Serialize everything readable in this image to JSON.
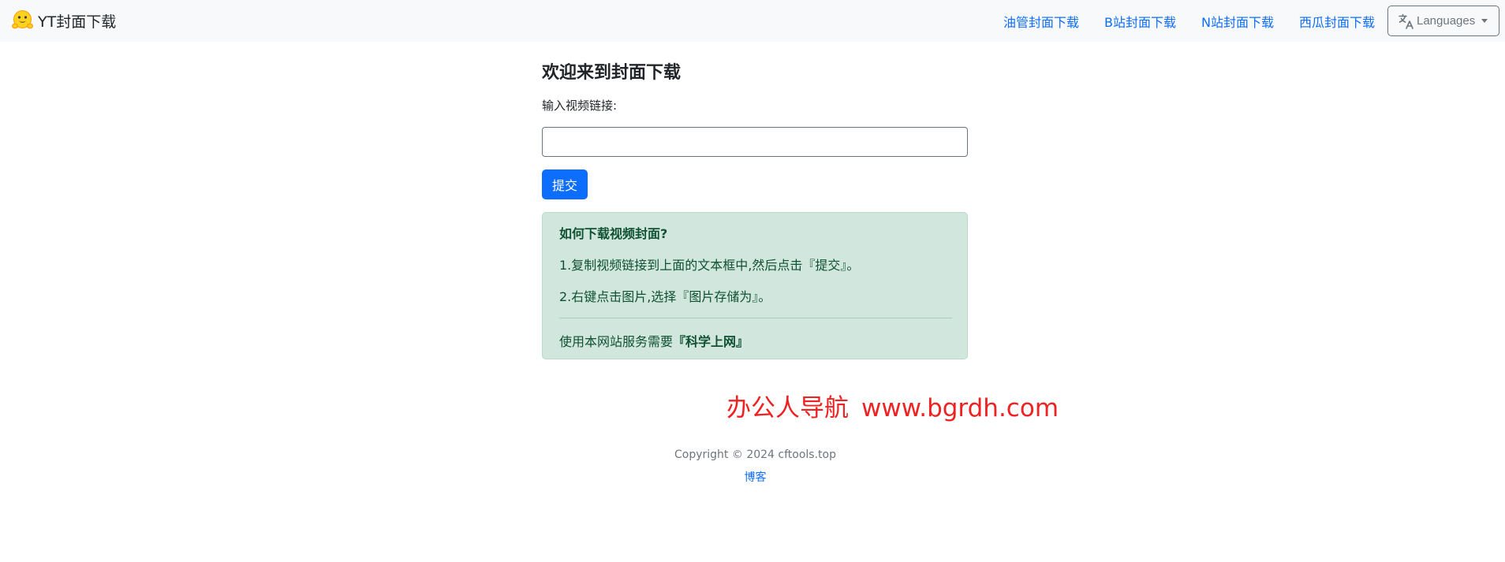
{
  "navbar": {
    "brand_text": "YT封面下载",
    "links": [
      {
        "label": "油管封面下载"
      },
      {
        "label": "B站封面下载"
      },
      {
        "label": "N站封面下载"
      },
      {
        "label": "西瓜封面下载"
      }
    ],
    "languages_label": "Languages"
  },
  "main": {
    "title": "欢迎来到封面下载",
    "input_label": "输入视频链接:",
    "input_value": "",
    "input_placeholder": "",
    "submit_label": "提交"
  },
  "help": {
    "heading": "如何下载视频封面?",
    "step1": "1.复制视频链接到上面的文本框中,然后点击『提交』。",
    "step2": "2.右键点击图片,选择『图片存储为』。",
    "note_prefix": "使用本网站服务需要",
    "note_strong": "『科学上网』"
  },
  "watermark": {
    "cn": "办公人导航",
    "url": "www.bgrdh.com"
  },
  "footer": {
    "copyright": "Copyright © 2024 cftools.top",
    "blog_label": "博客"
  },
  "colors": {
    "primary": "#0d6efd",
    "navbar_bg": "#f8f9fa",
    "alert_bg": "#d1e7dd",
    "alert_text": "#0f5132",
    "watermark": "#ee2222"
  },
  "icons": {
    "brand": "hugging-face-emoji-icon",
    "languages": "translate-icon",
    "dropdown": "caret-down-icon"
  }
}
